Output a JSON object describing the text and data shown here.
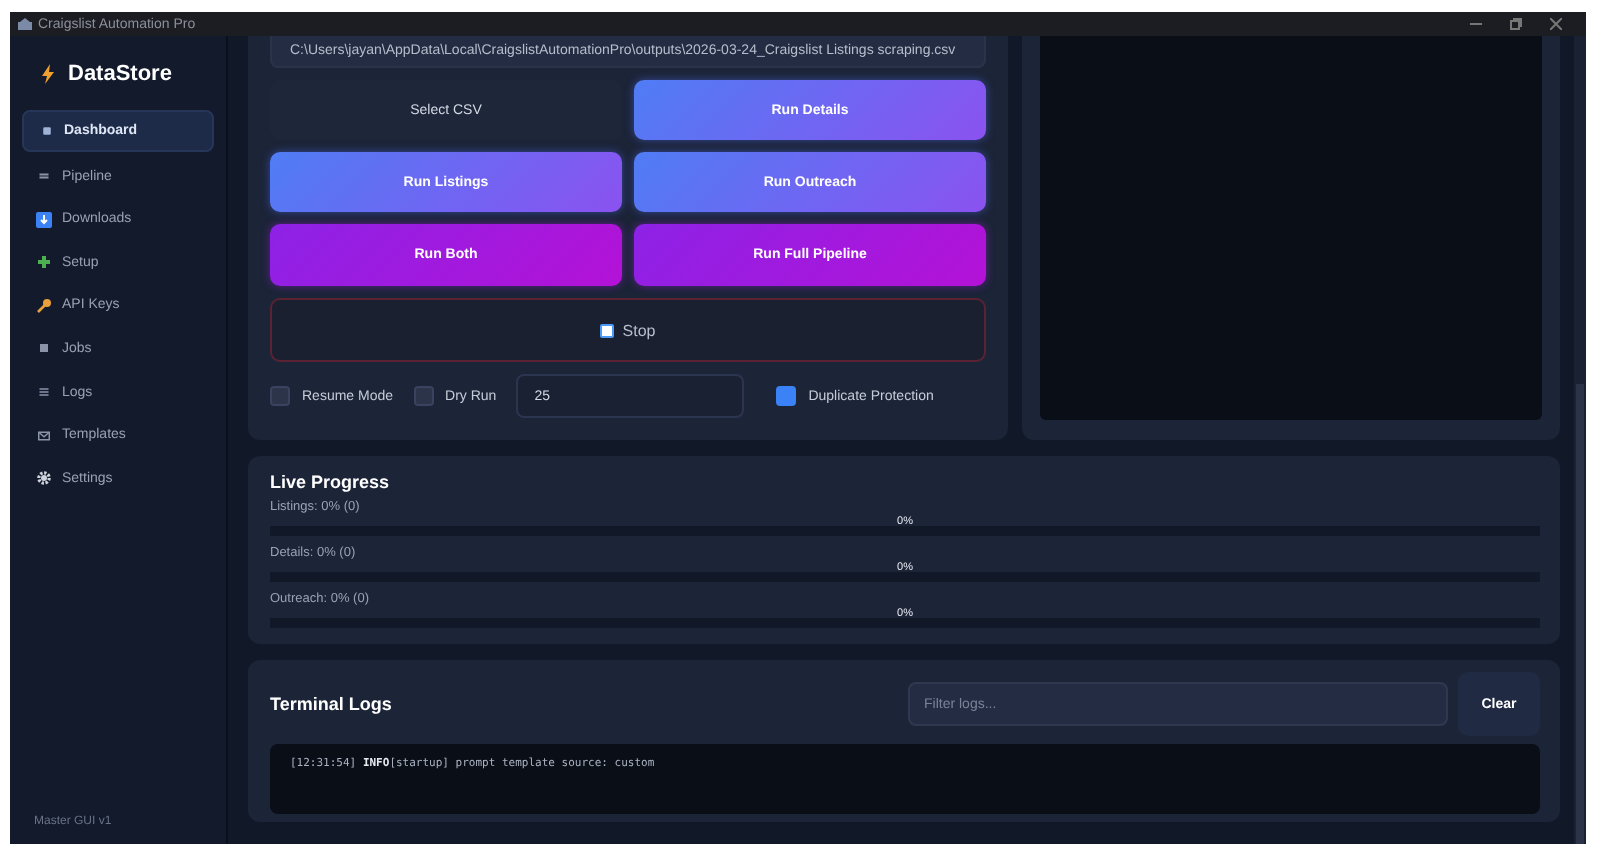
{
  "window": {
    "title": "Craigslist Automation Pro"
  },
  "sidebar": {
    "brand": "DataStore",
    "items": [
      {
        "label": "Dashboard",
        "selected": true
      },
      {
        "label": "Pipeline",
        "selected": false
      },
      {
        "label": "Downloads",
        "selected": false
      },
      {
        "label": "Setup",
        "selected": false
      },
      {
        "label": "API Keys",
        "selected": false
      },
      {
        "label": "Jobs",
        "selected": false
      },
      {
        "label": "Logs",
        "selected": false
      },
      {
        "label": "Templates",
        "selected": false
      },
      {
        "label": "Settings",
        "selected": false
      }
    ],
    "footer": "Master GUI v1"
  },
  "controls": {
    "csv_path": "C:\\Users\\jayan\\AppData\\Local\\CraigslistAutomationPro\\outputs\\2026-03-24_Craigslist Listings scraping.csv",
    "buttons": [
      {
        "label": "Select CSV",
        "kind": "plain"
      },
      {
        "label": "Run Details",
        "kind": "blue"
      },
      {
        "label": "Run Listings",
        "kind": "blue"
      },
      {
        "label": "Run Outreach",
        "kind": "blue"
      },
      {
        "label": "Run Both",
        "kind": "purple"
      },
      {
        "label": "Run Full Pipeline",
        "kind": "purple"
      },
      {
        "label": "Stop",
        "kind": "stop"
      }
    ],
    "options": [
      {
        "label": "Resume Mode",
        "checked": false
      },
      {
        "label": "Dry Run",
        "checked": false
      }
    ],
    "count": "25",
    "duplicate_protection": {
      "label": "Duplicate Protection",
      "checked": true
    }
  },
  "live_progress": {
    "title": "Live Progress",
    "rows": [
      {
        "label": "Listings: 0%  (0)",
        "level": 0,
        "reading": "0%"
      },
      {
        "label": "Details: 0%  (0)",
        "level": 0,
        "reading": "0%"
      },
      {
        "label": "Outreach: 0%  (0)",
        "level": 0,
        "reading": "0%"
      }
    ]
  },
  "terminal_logs": {
    "title": "Terminal Logs",
    "filter": {
      "placeholder": "Filter logs..."
    },
    "clear_button": "Clear",
    "lines": [
      "[12:31:54] **INFO**[startup] prompt template source: custom"
    ]
  }
}
